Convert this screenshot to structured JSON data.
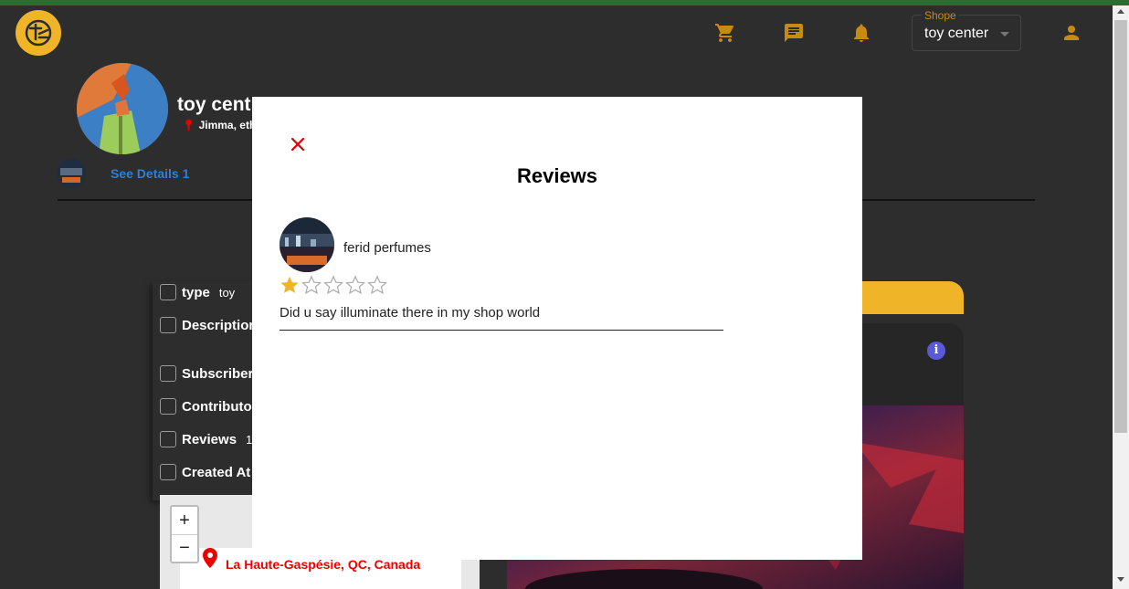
{
  "header": {
    "shop_select_label": "Shope",
    "shop_select_value": "toy center",
    "icons": [
      "cart-icon",
      "chat-icon",
      "bell-icon",
      "account-icon"
    ]
  },
  "profile": {
    "name": "toy cent",
    "location": "Jimma, ethi",
    "see_details": "See Details 1"
  },
  "info": {
    "type_label": "type",
    "type_value": "toy",
    "description_label": "Description",
    "subscribers_label": "Subscriber",
    "contributors_label": "Contributo",
    "reviews_label": "Reviews",
    "reviews_value": "1",
    "created_label": "Created At"
  },
  "map": {
    "zoom_in": "+",
    "zoom_out": "−",
    "location_label": "La Haute-Gaspésie, QC, Canada"
  },
  "right_panel": {
    "info_icon": "i"
  },
  "modal": {
    "title": "Reviews",
    "close_glyph": "✕",
    "reviews": [
      {
        "author": "ferid perfumes",
        "rating": 1,
        "max_rating": 5,
        "text": "Did u say illuminate there in my shop world"
      }
    ]
  },
  "colors": {
    "accent": "#c98a12",
    "logo": "#f0b429",
    "link": "#2f7fd6",
    "star_filled": "#f0b429",
    "close": "#e00000",
    "map_label": "#e00000"
  }
}
